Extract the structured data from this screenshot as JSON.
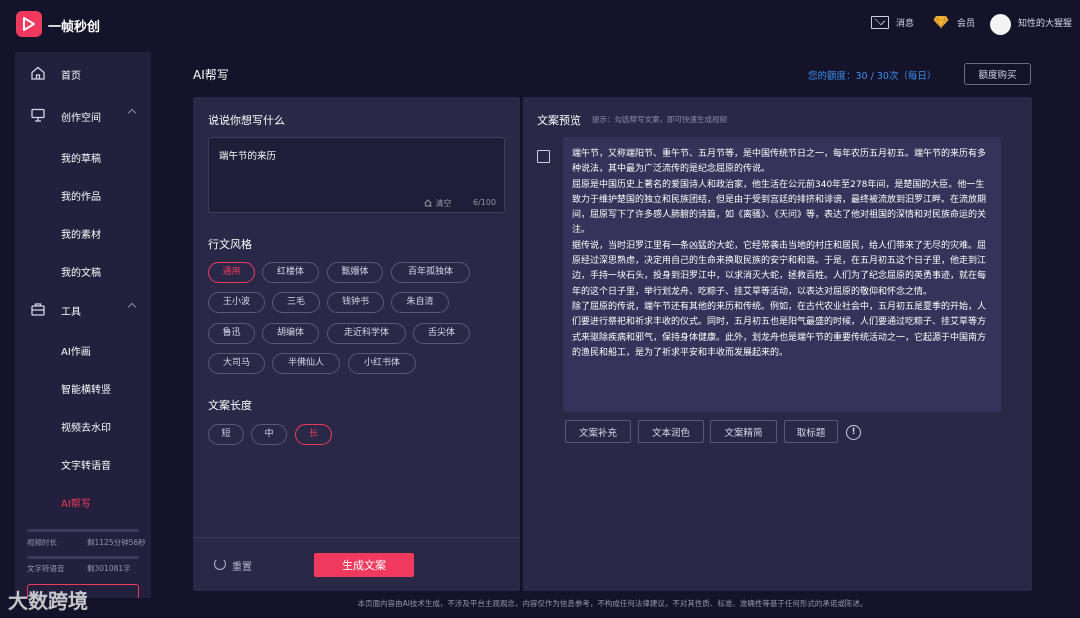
{
  "app": {
    "name": "一帧秒创"
  },
  "topbar": {
    "messages_label": "消息",
    "vip_label": "会员",
    "username": "知性的大猩猩"
  },
  "sidebar": {
    "home": "首页",
    "workspace": {
      "label": "创作空间",
      "items": [
        "我的草稿",
        "我的作品",
        "我的素材",
        "我的文稿"
      ]
    },
    "tools": {
      "label": "工具",
      "items": [
        "AI作画",
        "智能横转竖",
        "视频去水印",
        "文字转语音",
        "AI帮写"
      ],
      "active": "AI帮写"
    },
    "quota": [
      {
        "label": "视频时长",
        "value": "剩1125分钟56秒"
      },
      {
        "label": "文字转语音",
        "value": "剩301081字"
      }
    ]
  },
  "page": {
    "title": "AI帮写",
    "credit_text": "您的额度：30 / 30次（每日）",
    "buy_button": "额度购买"
  },
  "form": {
    "prompt_title": "说说你想写什么",
    "prompt_value": "端午节的来历",
    "clear_label": "清空",
    "counter": "6/100",
    "style_title": "行文风格",
    "styles": [
      "通用",
      "红楼体",
      "甄嬛体",
      "百年孤独体",
      "王小波",
      "三毛",
      "钱钟书",
      "朱自清",
      "鲁迅",
      "胡编体",
      "走近科学体",
      "舌尖体",
      "大司马",
      "半佛仙人",
      "小红书体"
    ],
    "selected_style": "通用",
    "length_title": "文案长度",
    "lengths": [
      "短",
      "中",
      "长"
    ],
    "selected_length": "长",
    "reset_label": "重置",
    "generate_label": "生成文案"
  },
  "preview": {
    "title": "文案预览",
    "hint": "提示：勾选帮写文案，即可快速生成视频",
    "paragraphs": [
      "端午节，又称端阳节、重午节、五月节等，是中国传统节日之一，每年农历五月初五。端午节的来历有多种说法，其中最为广泛流传的是纪念屈原的传说。",
      "屈原是中国历史上著名的爱国诗人和政治家，他生活在公元前340年至278年间，是楚国的大臣。他一生致力于维护楚国的独立和民族团结，但是由于受到宫廷的排挤和诽谤，最终被流放到汨罗江畔。在流放期间，屈原写下了许多感人肺腑的诗篇，如《离骚》、《天问》等，表达了他对祖国的深情和对民族命运的关注。",
      "据传说，当时汨罗江里有一条凶猛的大蛇，它经常袭击当地的村庄和居民，给人们带来了无尽的灾难。屈原经过深思熟虑，决定用自己的生命来换取民族的安宁和和谐。于是，在五月初五这个日子里，他走到江边，手持一块石头，投身到汨罗江中，以求消灭大蛇，拯救百姓。人们为了纪念屈原的英勇事迹，就在每年的这个日子里，举行划龙舟、吃粽子、挂艾草等活动，以表达对屈原的敬仰和怀念之情。",
      "除了屈原的传说，端午节还有其他的来历和传统。例如，在古代农业社会中，五月初五是夏季的开始，人们要进行祭祀和祈求丰收的仪式。同时，五月初五也是阳气最盛的时候，人们要通过吃粽子、挂艾草等方式来驱除疾病和邪气，保持身体健康。此外，划龙舟也是端午节的重要传统活动之一，它起源于中国南方的渔民和船工，是为了祈求平安和丰收而发展起来的。"
    ],
    "actions": [
      "文案补充",
      "文本润色",
      "文案精简",
      "取标题"
    ]
  },
  "footer": {
    "disclaimer": "本页面内容由AI技术生成，不涉及平台主观观念，内容仅作为信息参考，不构成任何法律建议，不对其性质、标准、准确性等基于任何形式的承诺或陈述。"
  },
  "watermark": "大数跨境",
  "colors": {
    "accent": "#ef3a5d",
    "link": "#3e8ff0",
    "bg": "#15132a",
    "panel": "#2a2847"
  }
}
